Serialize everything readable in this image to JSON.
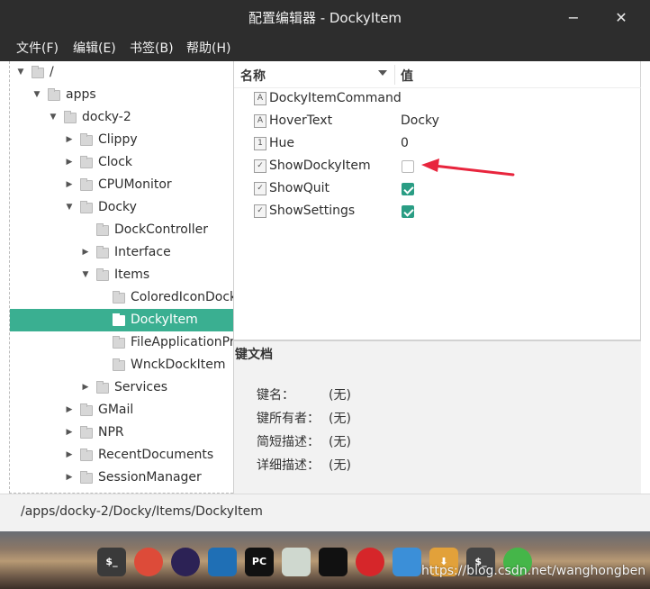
{
  "window": {
    "title": "配置编辑器 - DockyItem",
    "minimize_glyph": "−",
    "close_glyph": "✕"
  },
  "menubar": {
    "items": [
      "文件(F)",
      "编辑(E)",
      "书签(B)",
      "帮助(H)"
    ]
  },
  "tree": {
    "rows": [
      {
        "label": "/",
        "expanded": true
      },
      {
        "label": "apps",
        "expanded": true
      },
      {
        "label": "docky-2",
        "expanded": true
      },
      {
        "label": "Clippy",
        "expanded": false
      },
      {
        "label": "Clock",
        "expanded": false
      },
      {
        "label": "CPUMonitor",
        "expanded": false
      },
      {
        "label": "Docky",
        "expanded": true
      },
      {
        "label": "DockController"
      },
      {
        "label": "Interface",
        "expanded": false
      },
      {
        "label": "Items",
        "expanded": true
      },
      {
        "label": "ColoredIconDockIt"
      },
      {
        "label": "DockyItem",
        "selected": true
      },
      {
        "label": "FileApplicationPro"
      },
      {
        "label": "WnckDockItem"
      },
      {
        "label": "Services",
        "expanded": false
      },
      {
        "label": "GMail",
        "expanded": false
      },
      {
        "label": "NPR",
        "expanded": false
      },
      {
        "label": "RecentDocuments",
        "expanded": false
      },
      {
        "label": "SessionManager",
        "expanded": false
      }
    ]
  },
  "values": {
    "header_name": "名称",
    "header_value": "值",
    "rows": [
      {
        "type_icon": "A",
        "name": "DockyItemCommand",
        "value": ""
      },
      {
        "type_icon": "A",
        "name": "HoverText",
        "value": "Docky"
      },
      {
        "type_icon": "1",
        "name": "Hue",
        "value": "0"
      },
      {
        "type_icon": "✓",
        "name": "ShowDockyItem",
        "checked": false
      },
      {
        "type_icon": "✓",
        "name": "ShowQuit",
        "checked": true
      },
      {
        "type_icon": "✓",
        "name": "ShowSettings",
        "checked": true
      }
    ]
  },
  "doc": {
    "title": "键文档",
    "fields": [
      {
        "label": "键名：",
        "value": "(无)"
      },
      {
        "label": "键所有者：",
        "value": "(无)"
      },
      {
        "label": "简短描述：",
        "value": "(无)"
      },
      {
        "label": "详细描述：",
        "value": "(无)"
      }
    ]
  },
  "status": {
    "path": "/apps/docky-2/Docky/Items/DockyItem"
  },
  "dock": {
    "icons": [
      {
        "name": "terminal-icon",
        "glyph": "$_",
        "color": "#3a3a3a"
      },
      {
        "name": "chrome-icon",
        "glyph": "",
        "color": "#dd4b39"
      },
      {
        "name": "eclipse-icon",
        "glyph": "",
        "color": "#2c2255"
      },
      {
        "name": "vscode-icon",
        "glyph": "",
        "color": "#1f6fb5"
      },
      {
        "name": "pycharm-icon",
        "glyph": "PC",
        "color": "#111111"
      },
      {
        "name": "wechat-icon",
        "glyph": "",
        "color": "#cfd8cf"
      },
      {
        "name": "qq-icon",
        "glyph": "",
        "color": "#111111"
      },
      {
        "name": "netease-music-icon",
        "glyph": "",
        "color": "#d6262a"
      },
      {
        "name": "screenshot-icon",
        "glyph": "",
        "color": "#3b8fd8"
      },
      {
        "name": "downloader-icon",
        "glyph": "⬇",
        "color": "#e2a13a"
      },
      {
        "name": "terminal2-icon",
        "glyph": "$_",
        "color": "#444444"
      },
      {
        "name": "search-app-icon",
        "glyph": "",
        "color": "#45b649"
      }
    ]
  },
  "watermark": "https://blog.csdn.net/wanghongben"
}
